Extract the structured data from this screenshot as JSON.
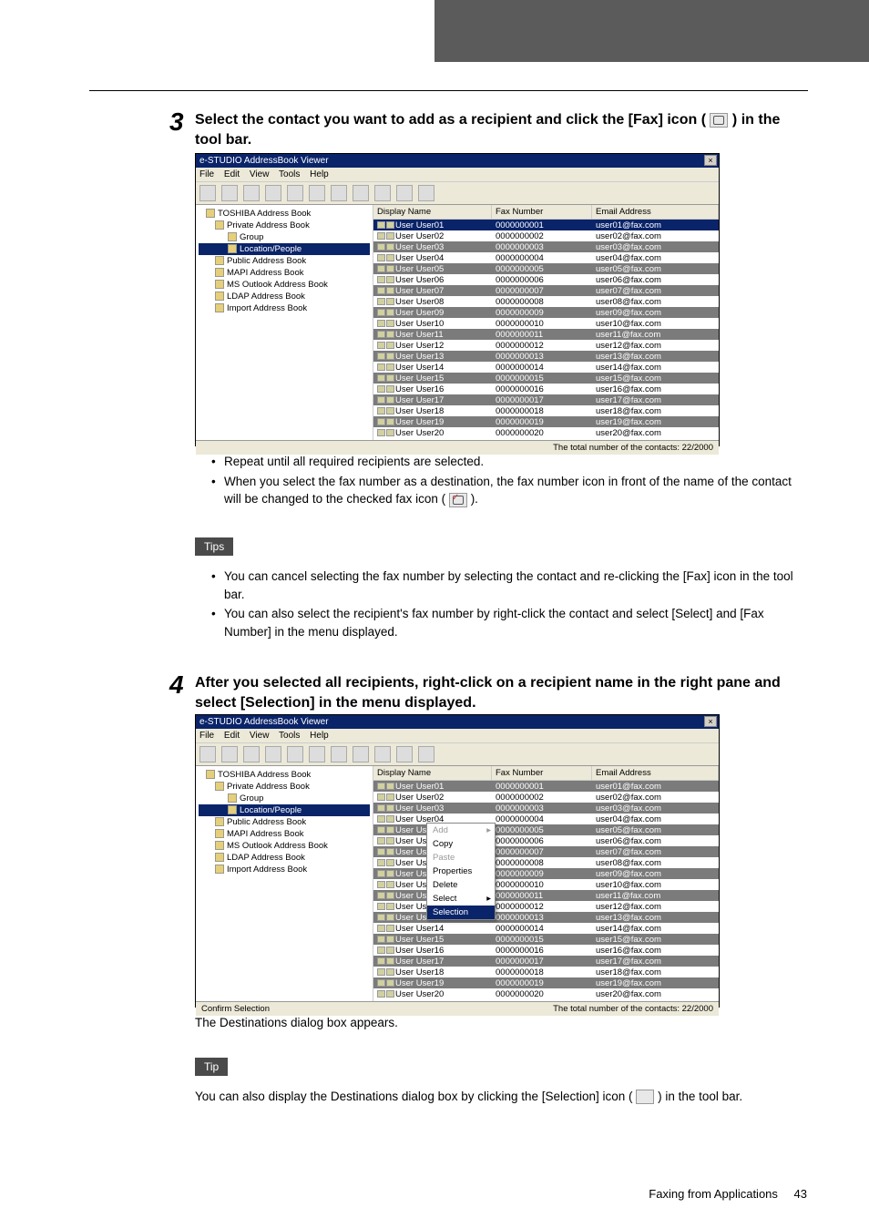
{
  "step3": {
    "num": "3",
    "text": "Select the contact you want to add as a recipient and click the [Fax] icon (",
    "text2": ") in the tool bar."
  },
  "step4": {
    "num": "4",
    "text": "After you selected all recipients, right-click on a recipient name in the right pane and select [Selection] in the menu displayed."
  },
  "screenshot": {
    "title": "e-STUDIO AddressBook Viewer",
    "menu": {
      "file": "File",
      "edit": "Edit",
      "view": "View",
      "tools": "Tools",
      "help": "Help"
    },
    "tree": {
      "root": "TOSHIBA Address Book",
      "priv": "Private Address Book",
      "group": "Group",
      "loc": "Location/People",
      "pub": "Public Address Book",
      "mapi": "MAPI Address Book",
      "ms": "MS Outlook Address Book",
      "ldap": "LDAP Address Book",
      "imp": "Import Address Book"
    },
    "columns": {
      "name": "Display Name",
      "fax": "Fax Number",
      "email": "Email Address"
    },
    "rows": [
      {
        "name": "User User01",
        "fax": "0000000001",
        "email": "user01@fax.com"
      },
      {
        "name": "User User02",
        "fax": "0000000002",
        "email": "user02@fax.com"
      },
      {
        "name": "User User03",
        "fax": "0000000003",
        "email": "user03@fax.com"
      },
      {
        "name": "User User04",
        "fax": "0000000004",
        "email": "user04@fax.com"
      },
      {
        "name": "User User05",
        "fax": "0000000005",
        "email": "user05@fax.com"
      },
      {
        "name": "User User06",
        "fax": "0000000006",
        "email": "user06@fax.com"
      },
      {
        "name": "User User07",
        "fax": "0000000007",
        "email": "user07@fax.com"
      },
      {
        "name": "User User08",
        "fax": "0000000008",
        "email": "user08@fax.com"
      },
      {
        "name": "User User09",
        "fax": "0000000009",
        "email": "user09@fax.com"
      },
      {
        "name": "User User10",
        "fax": "0000000010",
        "email": "user10@fax.com"
      },
      {
        "name": "User User11",
        "fax": "0000000011",
        "email": "user11@fax.com"
      },
      {
        "name": "User User12",
        "fax": "0000000012",
        "email": "user12@fax.com"
      },
      {
        "name": "User User13",
        "fax": "0000000013",
        "email": "user13@fax.com"
      },
      {
        "name": "User User14",
        "fax": "0000000014",
        "email": "user14@fax.com"
      },
      {
        "name": "User User15",
        "fax": "0000000015",
        "email": "user15@fax.com"
      },
      {
        "name": "User User16",
        "fax": "0000000016",
        "email": "user16@fax.com"
      },
      {
        "name": "User User17",
        "fax": "0000000017",
        "email": "user17@fax.com"
      },
      {
        "name": "User User18",
        "fax": "0000000018",
        "email": "user18@fax.com"
      },
      {
        "name": "User User19",
        "fax": "0000000019",
        "email": "user19@fax.com"
      },
      {
        "name": "User User20",
        "fax": "0000000020",
        "email": "user20@fax.com"
      }
    ],
    "status": "The total number of the contacts: 22/2000",
    "status2_left": "Confirm Selection"
  },
  "context_menu": {
    "add": "Add",
    "copy": "Copy",
    "paste": "Paste",
    "properties": "Properties",
    "delete": "Delete",
    "select": "Select",
    "selection": "Selection"
  },
  "bullets_after_ss1": {
    "b1": "Repeat until all required recipients are selected.",
    "b2a": "When you select the fax number as a destination, the fax number icon in front of the name of the contact will be changed to the checked fax icon (",
    "b2b": ")."
  },
  "tips_label": "Tips",
  "tip_label": "Tip",
  "tips_bullets": {
    "t1": "You can cancel selecting the fax number by selecting the contact and re-clicking the [Fax] icon in the tool bar.",
    "t2": "You can also select the recipient's fax number by right-click the contact and select [Select] and [Fax Number] in the menu displayed."
  },
  "after_ss2_text": "The Destinations dialog box appears.",
  "tip2_text_a": "You can also display the Destinations dialog box by clicking the [Selection] icon (",
  "tip2_text_b": ") in the tool bar.",
  "footer": {
    "section": "Faxing from Applications",
    "page": "43"
  }
}
